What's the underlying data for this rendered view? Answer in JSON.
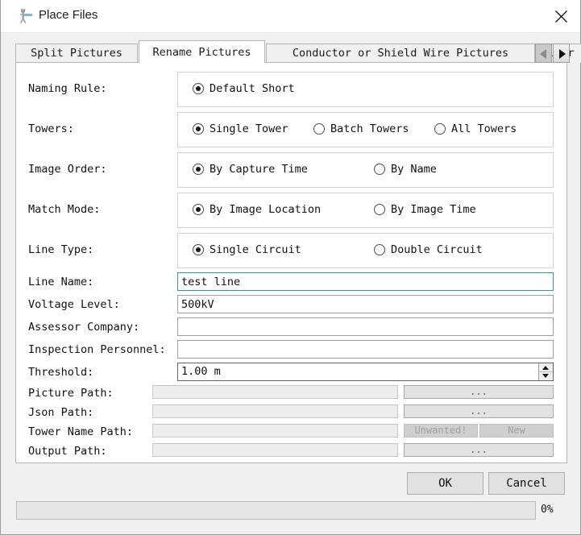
{
  "window": {
    "title": "Place Files",
    "icon": "person-with-wand-icon",
    "close_label": "×"
  },
  "tabs": [
    {
      "label": "Split Pictures",
      "selected": false
    },
    {
      "label": "Rename Pictures",
      "selected": true
    },
    {
      "label": "Conductor or Shield Wire Pictures",
      "selected": false
    },
    {
      "label": "Distr",
      "selected": false
    }
  ],
  "tab_scroll": {
    "left_label": "◄",
    "right_label": "►"
  },
  "form": {
    "radio_rows": [
      {
        "label": "Naming Rule:",
        "options": [
          {
            "label": "Default Short",
            "checked": true
          }
        ]
      },
      {
        "label": "Towers:",
        "options": [
          {
            "label": "Single Tower",
            "checked": true
          },
          {
            "label": "Batch Towers",
            "checked": false
          },
          {
            "label": "All Towers",
            "checked": false
          }
        ]
      },
      {
        "label": "Image Order:",
        "options": [
          {
            "label": "By Capture Time",
            "checked": true
          },
          {
            "label": "By Name",
            "checked": false
          }
        ]
      },
      {
        "label": "Match Mode:",
        "options": [
          {
            "label": "By Image Location",
            "checked": true
          },
          {
            "label": "By Image Time",
            "checked": false
          }
        ]
      },
      {
        "label": "Line Type:",
        "options": [
          {
            "label": "Single Circuit",
            "checked": true
          },
          {
            "label": "Double Circuit",
            "checked": false
          }
        ]
      }
    ],
    "text_rows": [
      {
        "label": "Line Name:",
        "value": "test line",
        "placeholder": "",
        "focused": true
      },
      {
        "label": "Voltage Level:",
        "value": "500kV",
        "placeholder": "",
        "focused": false
      },
      {
        "label": "Assessor Company:",
        "value": "",
        "placeholder": "",
        "focused": false
      },
      {
        "label": "Inspection Personnel:",
        "value": "",
        "placeholder": "",
        "focused": false
      }
    ],
    "threshold": {
      "label": "Threshold:",
      "value": "1.00 m"
    },
    "path_rows": [
      {
        "label": "Picture Path:",
        "value": "",
        "buttons": [
          {
            "label": "...",
            "disabled": false
          }
        ]
      },
      {
        "label": "Json Path:",
        "value": "",
        "buttons": [
          {
            "label": "...",
            "disabled": false
          }
        ]
      },
      {
        "label": "Tower Name Path:",
        "value": "",
        "buttons": [
          {
            "label": "Unwanted!",
            "disabled": true
          },
          {
            "label": "New",
            "disabled": true
          }
        ]
      },
      {
        "label": "Output Path:",
        "value": "",
        "buttons": [
          {
            "label": "...",
            "disabled": false
          }
        ]
      }
    ]
  },
  "footer": {
    "ok_label": "OK",
    "cancel_label": "Cancel",
    "progress_percent_label": "0%",
    "progress_value": 0
  },
  "colors": {
    "focus_border": "#3a8fad",
    "window_bg": "#f0f0f0",
    "panel_bg": "#ffffff",
    "disabled_text": "#a0a0a0"
  }
}
